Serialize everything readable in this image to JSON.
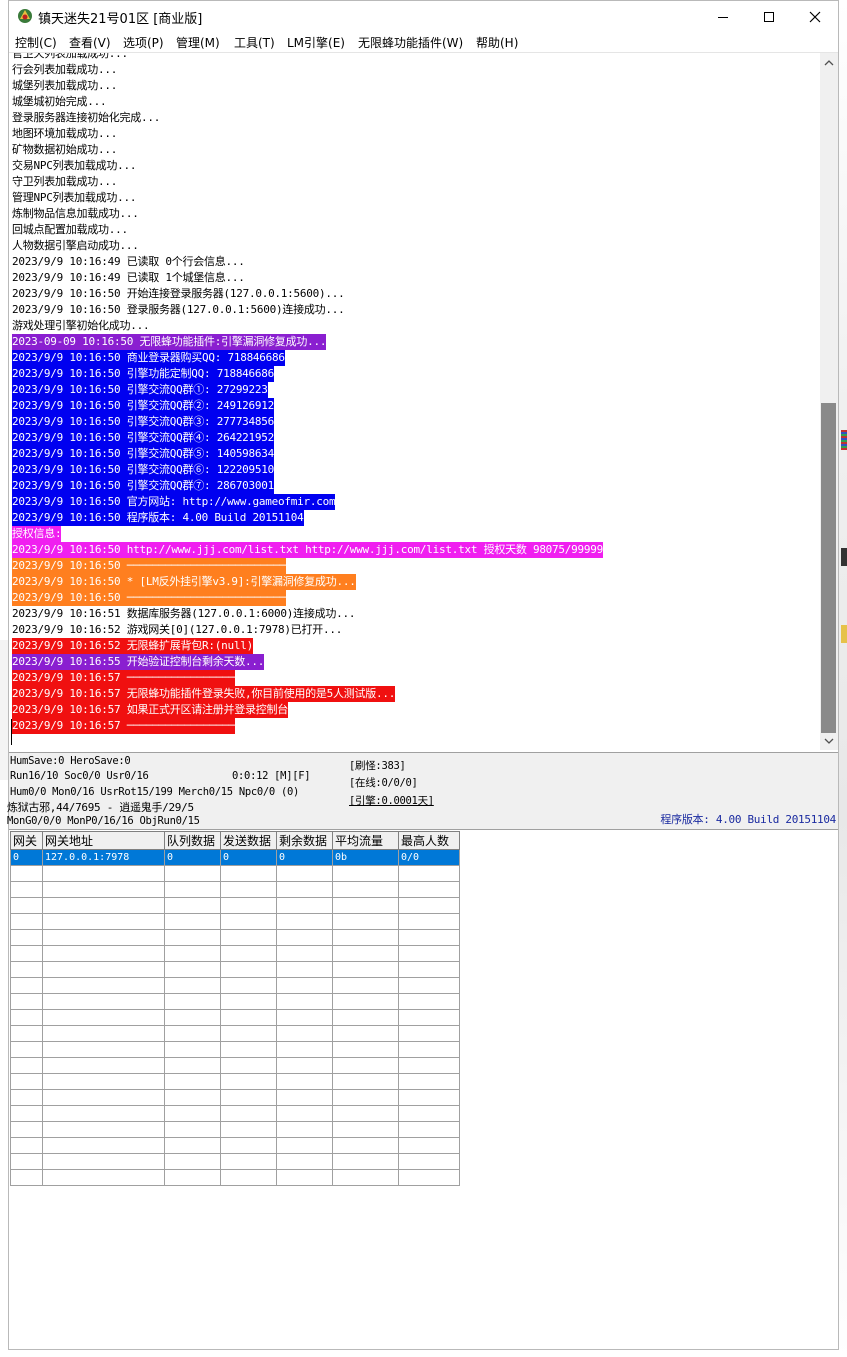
{
  "window": {
    "title": "镇天迷失21号01区 [商业版]",
    "controls": {
      "minimize": "minimize-icon",
      "maximize": "maximize-icon",
      "close": "close-icon"
    }
  },
  "menu": [
    {
      "label": "控制(C)"
    },
    {
      "label": "查看(V)"
    },
    {
      "label": "选项(P)"
    },
    {
      "label": "管理(M)"
    },
    {
      "label": "工具(T)"
    },
    {
      "label": "LM引擎(E)"
    },
    {
      "label": "无限蜂功能插件(W)"
    },
    {
      "label": "帮助(H)"
    }
  ],
  "colors": {
    "purple": "#8a1fd0",
    "blue": "#0000f0",
    "magenta": "#f01ff0",
    "orange": "#ff7f1f",
    "red": "#f01010",
    "selection": "#0078d7",
    "version_text": "#1a2aa0"
  },
  "log": [
    {
      "text": "官卫天列表加载成功...",
      "bg": "",
      "fg": "#000000"
    },
    {
      "text": "行会列表加载成功...",
      "bg": "",
      "fg": "#000000"
    },
    {
      "text": "城堡列表加载成功...",
      "bg": "",
      "fg": "#000000"
    },
    {
      "text": "城堡城初始完成...",
      "bg": "",
      "fg": "#000000"
    },
    {
      "text": "登录服务器连接初始化完成...",
      "bg": "",
      "fg": "#000000"
    },
    {
      "text": "地图环境加载成功...",
      "bg": "",
      "fg": "#000000"
    },
    {
      "text": "矿物数据初始成功...",
      "bg": "",
      "fg": "#000000"
    },
    {
      "text": "交易NPC列表加载成功...",
      "bg": "",
      "fg": "#000000"
    },
    {
      "text": "守卫列表加载成功...",
      "bg": "",
      "fg": "#000000"
    },
    {
      "text": "管理NPC列表加载成功...",
      "bg": "",
      "fg": "#000000"
    },
    {
      "text": "炼制物品信息加载成功...",
      "bg": "",
      "fg": "#000000"
    },
    {
      "text": "回城点配置加载成功...",
      "bg": "",
      "fg": "#000000"
    },
    {
      "text": "人物数据引擎启动成功...",
      "bg": "",
      "fg": "#000000"
    },
    {
      "text": "2023/9/9 10:16:49 已读取 0个行会信息...",
      "bg": "",
      "fg": "#000000"
    },
    {
      "text": "2023/9/9 10:16:49 已读取 1个城堡信息...",
      "bg": "",
      "fg": "#000000"
    },
    {
      "text": "2023/9/9 10:16:50 开始连接登录服务器(127.0.0.1:5600)...",
      "bg": "",
      "fg": "#000000"
    },
    {
      "text": "2023/9/9 10:16:50 登录服务器(127.0.0.1:5600)连接成功...",
      "bg": "",
      "fg": "#000000"
    },
    {
      "text": "游戏处理引擎初始化成功...",
      "bg": "",
      "fg": "#000000"
    },
    {
      "text": "2023-09-09 10:16:50 无限蜂功能插件:引擎漏洞修复成功...",
      "bg": "#8a1fd0",
      "fg": "#ffffff"
    },
    {
      "text": "2023/9/9 10:16:50 商业登录器购买QQ: 718846686",
      "bg": "#0000f0",
      "fg": "#ffffff"
    },
    {
      "text": "2023/9/9 10:16:50 引擎功能定制QQ: 718846686",
      "bg": "#0000f0",
      "fg": "#ffffff"
    },
    {
      "text": "2023/9/9 10:16:50 引擎交流QQ群①: 27299223",
      "bg": "#0000f0",
      "fg": "#ffffff"
    },
    {
      "text": "2023/9/9 10:16:50 引擎交流QQ群②: 249126912",
      "bg": "#0000f0",
      "fg": "#ffffff"
    },
    {
      "text": "2023/9/9 10:16:50 引擎交流QQ群③: 277734856",
      "bg": "#0000f0",
      "fg": "#ffffff"
    },
    {
      "text": "2023/9/9 10:16:50 引擎交流QQ群④: 264221952",
      "bg": "#0000f0",
      "fg": "#ffffff"
    },
    {
      "text": "2023/9/9 10:16:50 引擎交流QQ群⑤: 140598634",
      "bg": "#0000f0",
      "fg": "#ffffff"
    },
    {
      "text": "2023/9/9 10:16:50 引擎交流QQ群⑥: 122209510",
      "bg": "#0000f0",
      "fg": "#ffffff"
    },
    {
      "text": "2023/9/9 10:16:50 引擎交流QQ群⑦: 286703001",
      "bg": "#0000f0",
      "fg": "#ffffff"
    },
    {
      "text": "2023/9/9 10:16:50 官方网站: http://www.gameofmir.com",
      "bg": "#0000f0",
      "fg": "#ffffff"
    },
    {
      "text": "2023/9/9 10:16:50 程序版本: 4.00 Build 20151104",
      "bg": "#0000f0",
      "fg": "#ffffff"
    },
    {
      "text": "授权信息:",
      "bg": "#f01ff0",
      "fg": "#ffffff"
    },
    {
      "text": "2023/9/9 10:16:50 http://www.jjj.com/list.txt http://www.jjj.com/list.txt 授权天数 98075/99999",
      "bg": "#f01ff0",
      "fg": "#ffffff"
    },
    {
      "text": "2023/9/9 10:16:50 ─────────────────────────",
      "bg": "#ff7f1f",
      "fg": "#ffffff"
    },
    {
      "text": "2023/9/9 10:16:50 * [LM反外挂引擎v3.9]:引擎漏洞修复成功...",
      "bg": "#ff7f1f",
      "fg": "#ffffff"
    },
    {
      "text": "2023/9/9 10:16:50 ─────────────────────────",
      "bg": "#ff7f1f",
      "fg": "#ffffff"
    },
    {
      "text": "2023/9/9 10:16:51 数据库服务器(127.0.0.1:6000)连接成功...",
      "bg": "",
      "fg": "#000000"
    },
    {
      "text": "2023/9/9 10:16:52 游戏网关[0](127.0.0.1:7978)已打开...",
      "bg": "",
      "fg": "#000000"
    },
    {
      "text": "2023/9/9 10:16:52 无限蜂扩展背包R:(null)",
      "bg": "#f01010",
      "fg": "#ffffff"
    },
    {
      "text": "2023/9/9 10:16:55 开始验证控制台剩余天数...",
      "bg": "#8a1fd0",
      "fg": "#ffffff"
    },
    {
      "text": "2023/9/9 10:16:57 ─────────────────",
      "bg": "#f01010",
      "fg": "#ffffff"
    },
    {
      "text": "2023/9/9 10:16:57 无限蜂功能插件登录失败,你目前使用的是5人测试版...",
      "bg": "#f01010",
      "fg": "#ffffff"
    },
    {
      "text": "2023/9/9 10:16:57 如果正式开区请注册并登录控制台",
      "bg": "#f01010",
      "fg": "#ffffff"
    },
    {
      "text": "2023/9/9 10:16:57 ─────────────────",
      "bg": "#f01010",
      "fg": "#ffffff"
    }
  ],
  "status": {
    "line1": "HumSave:0 HeroSave:0",
    "line2": "Run16/10 Soc0/0 Usr0/16",
    "line2b": "0:0:12 [M][F]",
    "line3": "Hum0/0 Mon0/16 UsrRot15/199 Merch0/15 Npc0/0 (0)",
    "line4": "炼狱古邪,44/7695 - 逍遥鬼手/29/5",
    "line5": "MonG0/0/0 MonP0/16/16 ObjRun0/15",
    "refresh": "[刷怪:383]",
    "online": "[在线:0/0/0]",
    "engine": "[引擎:0.0001天]",
    "version": "程序版本: 4.00 Build 20151104"
  },
  "grid": {
    "columns": [
      "网关",
      "网关地址",
      "队列数据",
      "发送数据",
      "剩余数据",
      "平均流量",
      "最高人数"
    ],
    "rows": [
      [
        "0",
        "127.0.0.1:7978",
        "0",
        "0",
        "0",
        "0b",
        "0/0"
      ]
    ],
    "empty_rows": 20
  }
}
